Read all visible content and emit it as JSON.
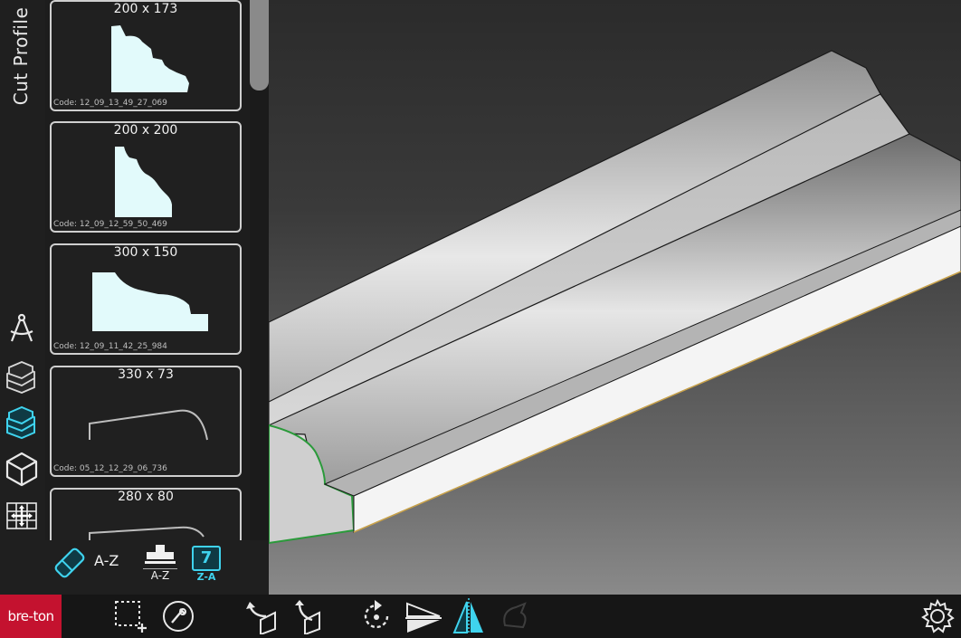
{
  "panel": {
    "title": "Cut Profile"
  },
  "profiles": [
    {
      "dimensions": "200 x 173",
      "code": "Code: 12_09_13_49_27_069"
    },
    {
      "dimensions": "200 x 200",
      "code": "Code: 12_09_12_59_50_469"
    },
    {
      "dimensions": "300 x 150",
      "code": "Code: 12_09_11_42_25_984"
    },
    {
      "dimensions": "330 x 73",
      "code": "Code: 05_12_12_29_06_736"
    },
    {
      "dimensions": "280 x 80",
      "code": ""
    }
  ],
  "sort": {
    "az_label": "A-Z",
    "az_sub": "A-Z",
    "calendar_day": "7",
    "calendar_sub": "Z-A"
  },
  "brand": {
    "logo_text": "bre-ton"
  },
  "icons": {
    "rail": [
      "compass-icon",
      "stacked-profiles-icon",
      "profile-library-icon",
      "cube-icon",
      "dimension-grid-icon",
      "disk-export-icon"
    ],
    "toolbar": [
      "add-selection-icon",
      "settings-knob-icon",
      "rotate-left-icon",
      "rotate-right-icon",
      "rotate-view-icon",
      "flip-icon",
      "mirror-icon",
      "disabled-tool-icon",
      "gear-icon"
    ]
  },
  "colors": {
    "accent": "#3fd3ee",
    "brand": "#c4122f",
    "profile_fill": "#e2fafb",
    "edge_green": "#2a9a3a"
  }
}
